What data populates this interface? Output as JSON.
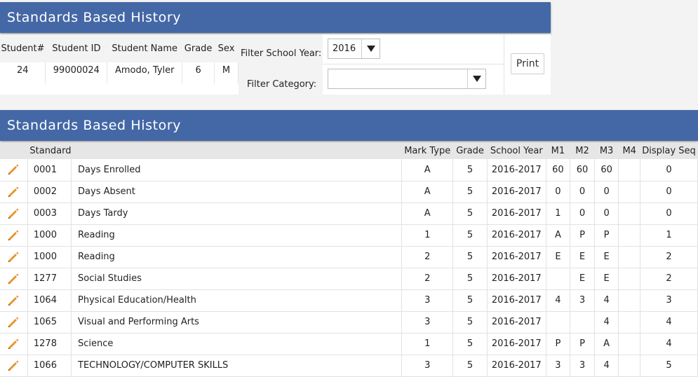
{
  "top_panel": {
    "title": "Standards Based History",
    "columns": [
      "Student#",
      "Student ID",
      "Student Name",
      "Grade",
      "Sex"
    ],
    "student": {
      "number": "24",
      "id": "99000024",
      "name": "Amodo, Tyler",
      "grade": "6",
      "sex": "M"
    },
    "filter_year_label": "Filter School Year:",
    "filter_year_value": "2016",
    "filter_category_label": "Filter Category:",
    "filter_category_value": "",
    "print_label": "Print"
  },
  "grid_panel": {
    "title": "Standards Based History",
    "columns": [
      "",
      "Standard",
      "",
      "Mark Type",
      "Grade",
      "School Year",
      "M1",
      "M2",
      "M3",
      "M4",
      "Display Seq"
    ],
    "rows": [
      {
        "code": "0001",
        "name": "Days Enrolled",
        "mark_type": "A",
        "grade": "5",
        "year": "2016-2017",
        "m1": "60",
        "m2": "60",
        "m3": "60",
        "m4": "",
        "seq": "0"
      },
      {
        "code": "0002",
        "name": "Days Absent",
        "mark_type": "A",
        "grade": "5",
        "year": "2016-2017",
        "m1": "0",
        "m2": "0",
        "m3": "0",
        "m4": "",
        "seq": "0"
      },
      {
        "code": "0003",
        "name": "Days Tardy",
        "mark_type": "A",
        "grade": "5",
        "year": "2016-2017",
        "m1": "1",
        "m2": "0",
        "m3": "0",
        "m4": "",
        "seq": "0"
      },
      {
        "code": "1000",
        "name": "Reading",
        "mark_type": "1",
        "grade": "5",
        "year": "2016-2017",
        "m1": "A",
        "m2": "P",
        "m3": "P",
        "m4": "",
        "seq": "1"
      },
      {
        "code": "1000",
        "name": "Reading",
        "mark_type": "2",
        "grade": "5",
        "year": "2016-2017",
        "m1": "E",
        "m2": "E",
        "m3": "E",
        "m4": "",
        "seq": "2"
      },
      {
        "code": "1277",
        "name": "Social Studies",
        "mark_type": "2",
        "grade": "5",
        "year": "2016-2017",
        "m1": "",
        "m2": "E",
        "m3": "E",
        "m4": "",
        "seq": "2"
      },
      {
        "code": "1064",
        "name": "Physical Education/Health",
        "mark_type": "3",
        "grade": "5",
        "year": "2016-2017",
        "m1": "4",
        "m2": "3",
        "m3": "4",
        "m4": "",
        "seq": "3"
      },
      {
        "code": "1065",
        "name": "Visual and Performing Arts",
        "mark_type": "3",
        "grade": "5",
        "year": "2016-2017",
        "m1": "",
        "m2": "",
        "m3": "4",
        "m4": "",
        "seq": "4"
      },
      {
        "code": "1278",
        "name": "Science",
        "mark_type": "1",
        "grade": "5",
        "year": "2016-2017",
        "m1": "P",
        "m2": "P",
        "m3": "A",
        "m4": "",
        "seq": "4"
      },
      {
        "code": "1066",
        "name": "TECHNOLOGY/COMPUTER SKILLS",
        "mark_type": "3",
        "grade": "5",
        "year": "2016-2017",
        "m1": "3",
        "m2": "3",
        "m3": "4",
        "m4": "",
        "seq": "5"
      }
    ]
  },
  "colors": {
    "header_bg": "#4468a6",
    "edit_icon": "#e8932a"
  },
  "icons": {
    "edit": "pencil-icon",
    "dropdown": "triangle-down-icon"
  }
}
